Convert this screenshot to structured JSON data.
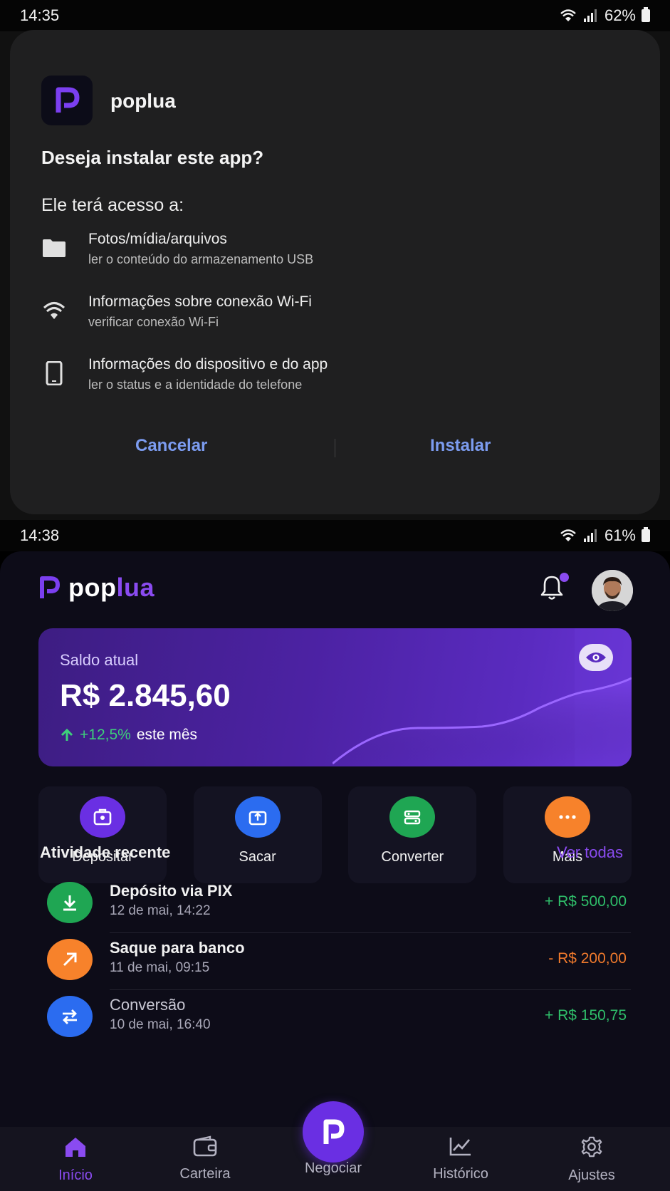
{
  "status_top": {
    "time": "14:35",
    "battery": "62%"
  },
  "install_dialog": {
    "app_name": "poplua",
    "question": "Deseja instalar este app?",
    "access_title": "Ele terá acesso a:",
    "permissions": [
      {
        "title": "Fotos/mídia/arquivos",
        "desc": "ler o conteúdo do armazenamento USB",
        "icon": "folder-icon"
      },
      {
        "title": "Informações sobre conexão Wi-Fi",
        "desc": "verificar conexão Wi-Fi",
        "icon": "wifi-icon"
      },
      {
        "title": "Informações do dispositivo e do app",
        "desc": "ler o status e a identidade do telefone",
        "icon": "phone-icon"
      }
    ],
    "cancel_label": "Cancelar",
    "install_label": "Instalar"
  },
  "status_bottom": {
    "time": "14:38",
    "battery": "61%"
  },
  "app": {
    "logo_pop": "pop",
    "logo_lua": "lua",
    "balance": {
      "label": "Saldo atual",
      "amount": "R$ 2.845,60",
      "change_pct": "+12,5%",
      "change_text": "este mês"
    },
    "actions": [
      {
        "label": "Depositar",
        "color": "#6a2fe3",
        "icon": "deposit-icon"
      },
      {
        "label": "Sacar",
        "color": "#2b6cf0",
        "icon": "withdraw-icon"
      },
      {
        "label": "Converter",
        "color": "#1fa653",
        "icon": "convert-icon"
      },
      {
        "label": "Mais",
        "color": "#f7822b",
        "icon": "more-icon"
      }
    ],
    "recent": {
      "title": "Atividade recente",
      "see_all": "Ver todas",
      "items": [
        {
          "name": "Depósito via PIX",
          "date": "12 de mai, 14:22",
          "amount": "+ R$ 500,00",
          "amount_color": "#2fbf6a",
          "icon_color": "#1fa653",
          "icon": "download-icon"
        },
        {
          "name": "Saque para banco",
          "date": "11 de mai, 09:15",
          "amount": "- R$ 200,00",
          "amount_color": "#f07a2c",
          "icon_color": "#f7822b",
          "icon": "arrow-up-right-icon"
        },
        {
          "name": "Conversão",
          "date": "10 de mai, 16:40",
          "amount": "+ R$ 150,75",
          "amount_color": "#2fbf6a",
          "icon_color": "#2b6cf0",
          "icon": "swap-icon"
        }
      ]
    },
    "nav": {
      "home": "Início",
      "wallet": "Carteira",
      "trade": "Negociar",
      "history": "Histórico",
      "settings": "Ajustes"
    }
  }
}
